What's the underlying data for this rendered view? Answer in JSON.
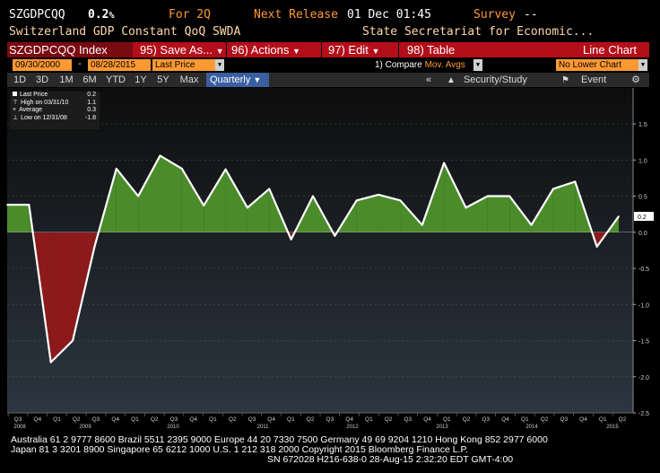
{
  "header": {
    "ticker": "SZGDPCQQ",
    "last_value": "0.2",
    "value_suffix": "%",
    "period_label": "For 2Q",
    "next_release_label": "Next Release",
    "next_release_date": "01 Dec 01:45",
    "survey_label": "Survey",
    "survey_value": "--",
    "title": "Switzerland GDP Constant QoQ SWDA",
    "source": "State Secretariat for Economic..."
  },
  "menu": {
    "index": "SZGDPCQQ Index",
    "save": "95) Save As...",
    "actions": "96) Actions",
    "edit": "97) Edit",
    "table": "98) Table",
    "chart_type": "Line Chart"
  },
  "range": {
    "start": "09/30/2000",
    "separator": "-",
    "end": "08/28/2015",
    "field": "Last Price",
    "compare_label": "1) Compare",
    "compare_value": "Mov. Avgs",
    "lower_chart": "No Lower Chart"
  },
  "toolbar": {
    "periods": [
      "1D",
      "3D",
      "1M",
      "6M",
      "YTD",
      "1Y",
      "5Y",
      "Max"
    ],
    "frequency": "Quarterly",
    "collapse": "«",
    "security_study": "Security/Study",
    "event": "Event"
  },
  "legend": {
    "items": [
      {
        "label": "Last Price",
        "value": "0.2"
      },
      {
        "label": "High on 03/31/10",
        "value": "1.1"
      },
      {
        "label": "Average",
        "value": "0.3"
      },
      {
        "label": "Low on 12/31/08",
        "value": "-1.8"
      }
    ]
  },
  "chart_data": {
    "type": "area",
    "y_ticks": [
      "1.5",
      "1.0",
      "0.5",
      "0.0",
      "-0.5",
      "-1.0",
      "-1.5",
      "-2.0",
      "-2.5"
    ],
    "ylim": [
      -2.5,
      1.5
    ],
    "last_value_tag": "0.2",
    "quarter_labels": [
      "Q3",
      "Q4",
      "Q1",
      "Q2",
      "Q3",
      "Q4",
      "Q1",
      "Q2",
      "Q3",
      "Q4",
      "Q1",
      "Q2",
      "Q3",
      "Q4",
      "Q1",
      "Q2",
      "Q3",
      "Q4",
      "Q1",
      "Q2",
      "Q3",
      "Q4",
      "Q1",
      "Q2",
      "Q3",
      "Q4",
      "Q1",
      "Q2",
      "Q3",
      "Q4",
      "Q1",
      "Q2"
    ],
    "year_labels": [
      "2008",
      "2009",
      "2010",
      "2011",
      "2012",
      "2013",
      "2014",
      "2015"
    ],
    "values": [
      0.38,
      0.38,
      -1.8,
      -1.5,
      -0.2,
      0.88,
      0.5,
      1.06,
      0.88,
      0.37,
      0.87,
      0.34,
      0.6,
      -0.1,
      0.5,
      -0.05,
      0.44,
      0.52,
      0.44,
      0.1,
      0.96,
      0.34,
      0.5,
      0.5,
      0.1,
      0.6,
      0.7,
      -0.2,
      0.22
    ],
    "positive_color": "#4a8c2a",
    "negative_color": "#8c1a1a",
    "line_color": "#ffffff"
  },
  "footer": {
    "line1": "Australia 61 2 9777 8600 Brazil 5511 2395 9000 Europe 44 20 7330 7500 Germany 49 69 9204 1210 Hong Kong 852 2977 6000",
    "line2": "Japan 81 3 3201 8900        Singapore 65 6212 1000        U.S. 1 212 318 2000         Copyright 2015 Bloomberg Finance L.P.",
    "line3": "SN 672028 H216-638-0 28-Aug-15   2:32:20 EDT  GMT-4:00"
  }
}
